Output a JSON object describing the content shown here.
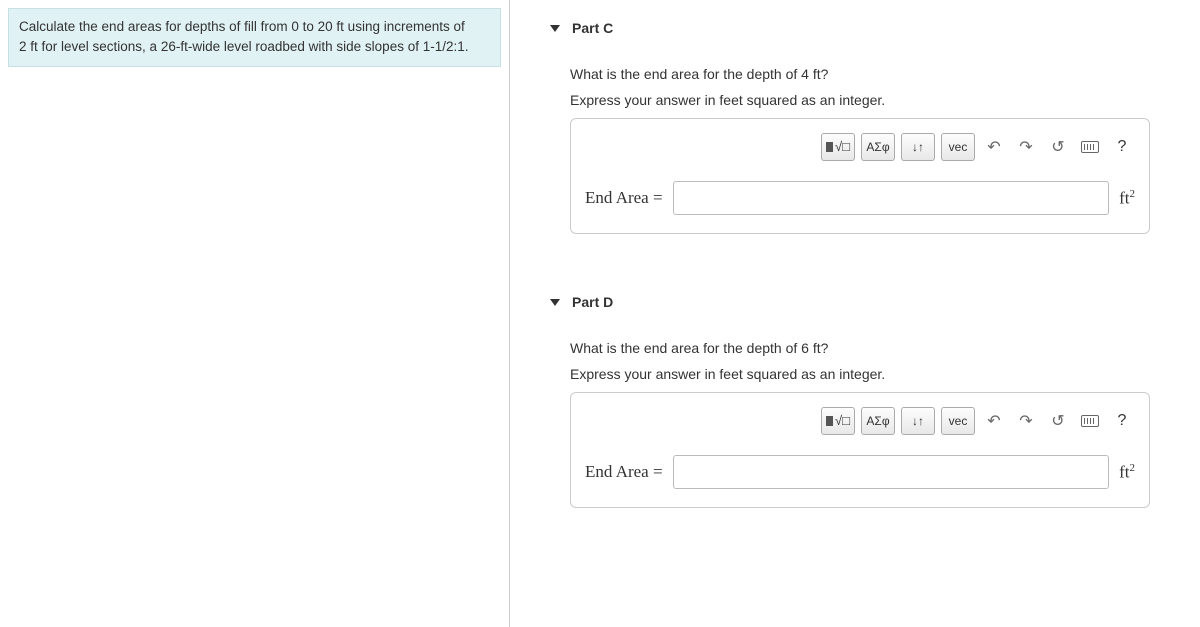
{
  "problem": {
    "text_1": "Calculate the end areas for depths of fill from 0 to 20 ft using increments of",
    "text_2": "2 ft for level sections, a 26-ft-wide level roadbed with side slopes of 1-1/2:1."
  },
  "parts": [
    {
      "title": "Part C",
      "question": "What is the end area for the depth of 4 ft?",
      "instruction": "Express your answer in feet squared as an integer.",
      "label": "End Area =",
      "unit_base": "ft",
      "unit_exp": "2"
    },
    {
      "title": "Part D",
      "question": "What is the end area for the depth of 6 ft?",
      "instruction": "Express your answer in feet squared as an integer.",
      "label": "End Area =",
      "unit_base": "ft",
      "unit_exp": "2"
    }
  ],
  "toolbar": {
    "greek": "ΑΣφ",
    "arrows": "↓↑",
    "vec": "vec",
    "undo": "↶",
    "redo": "↷",
    "reset": "↺",
    "help": "?"
  }
}
